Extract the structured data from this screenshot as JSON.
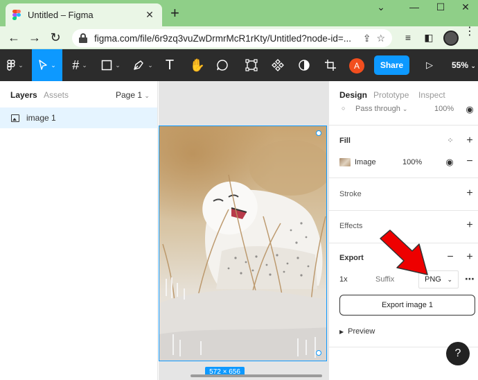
{
  "browser": {
    "tab_title": "Untitled – Figma",
    "tab_close": "✕",
    "new_tab": "+",
    "win_min": "⌄",
    "win_minimize": "—",
    "win_restore": "☐",
    "win_close": "✕",
    "back": "←",
    "forward": "→",
    "reload": "↻",
    "url": "figma.com/file/6r9zq3vuZwDrmrMcR1rKty/Untitled?node-id=..."
  },
  "toolbar": {
    "share_label": "Share",
    "zoom_label": "55%",
    "user_initial": "A",
    "text_tool": "T"
  },
  "left_panel": {
    "tabs": [
      "Layers",
      "Assets"
    ],
    "page_label": "Page 1",
    "layers": [
      {
        "name": "image 1"
      }
    ]
  },
  "canvas": {
    "dimensions": "572 × 656"
  },
  "right_panel": {
    "tabs": [
      "Design",
      "Prototype",
      "Inspect"
    ],
    "layer_blend": "Pass through",
    "layer_opacity": "100%",
    "fill": {
      "title": "Fill",
      "type": "Image",
      "opacity": "100%"
    },
    "stroke_title": "Stroke",
    "effects_title": "Effects",
    "export": {
      "title": "Export",
      "scale": "1x",
      "suffix_placeholder": "Suffix",
      "format": "PNG",
      "button_label": "Export image 1",
      "preview_label": "Preview"
    },
    "help_label": "?"
  },
  "colors": {
    "accent": "#0d99ff",
    "toolbar_bg": "#2c2c2c",
    "chrome_bg": "#8fcf88",
    "arrow": "#ee0000"
  }
}
